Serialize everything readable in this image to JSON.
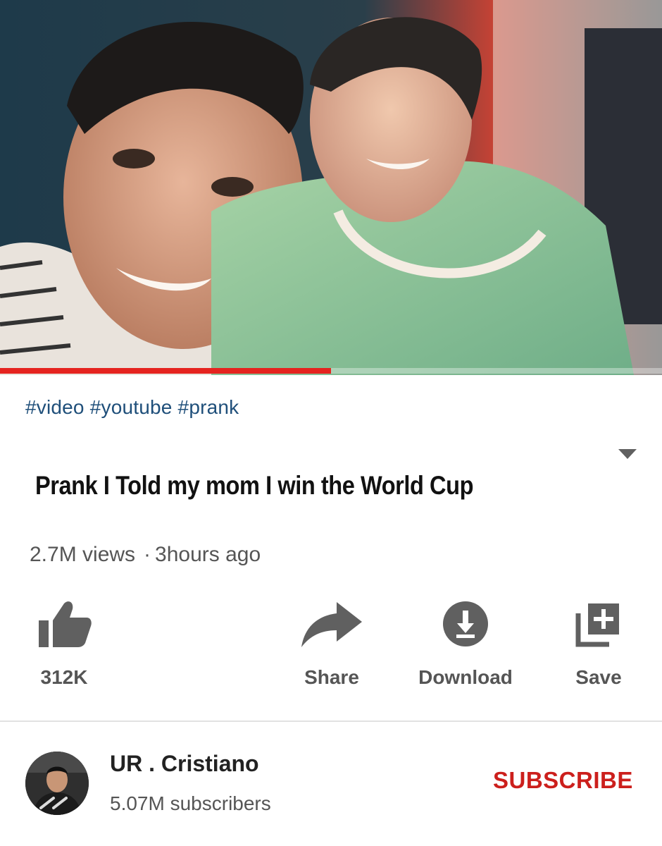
{
  "video": {
    "progress_fraction": 0.5
  },
  "hashtags": [
    "#video",
    "#youtube",
    "#prank"
  ],
  "title": "Prank I Told my mom I win the World Cup",
  "meta": {
    "views": "2.7M views",
    "separator": "·",
    "age": "3hours ago"
  },
  "actions": {
    "like": {
      "label": "312K",
      "icon": "thumbs-up-icon"
    },
    "share": {
      "label": "Share",
      "icon": "share-arrow-icon"
    },
    "download": {
      "label": "Download",
      "icon": "download-icon"
    },
    "save": {
      "label": "Save",
      "icon": "playlist-add-icon"
    }
  },
  "channel": {
    "name": "UR . Cristiano",
    "subscribers": "5.07M subscribers",
    "subscribe_label": "SUBSCRIBE"
  },
  "colors": {
    "progress": "#e5231f",
    "subscribe": "#cc1f1c",
    "hashtag": "#1f4f7a"
  }
}
